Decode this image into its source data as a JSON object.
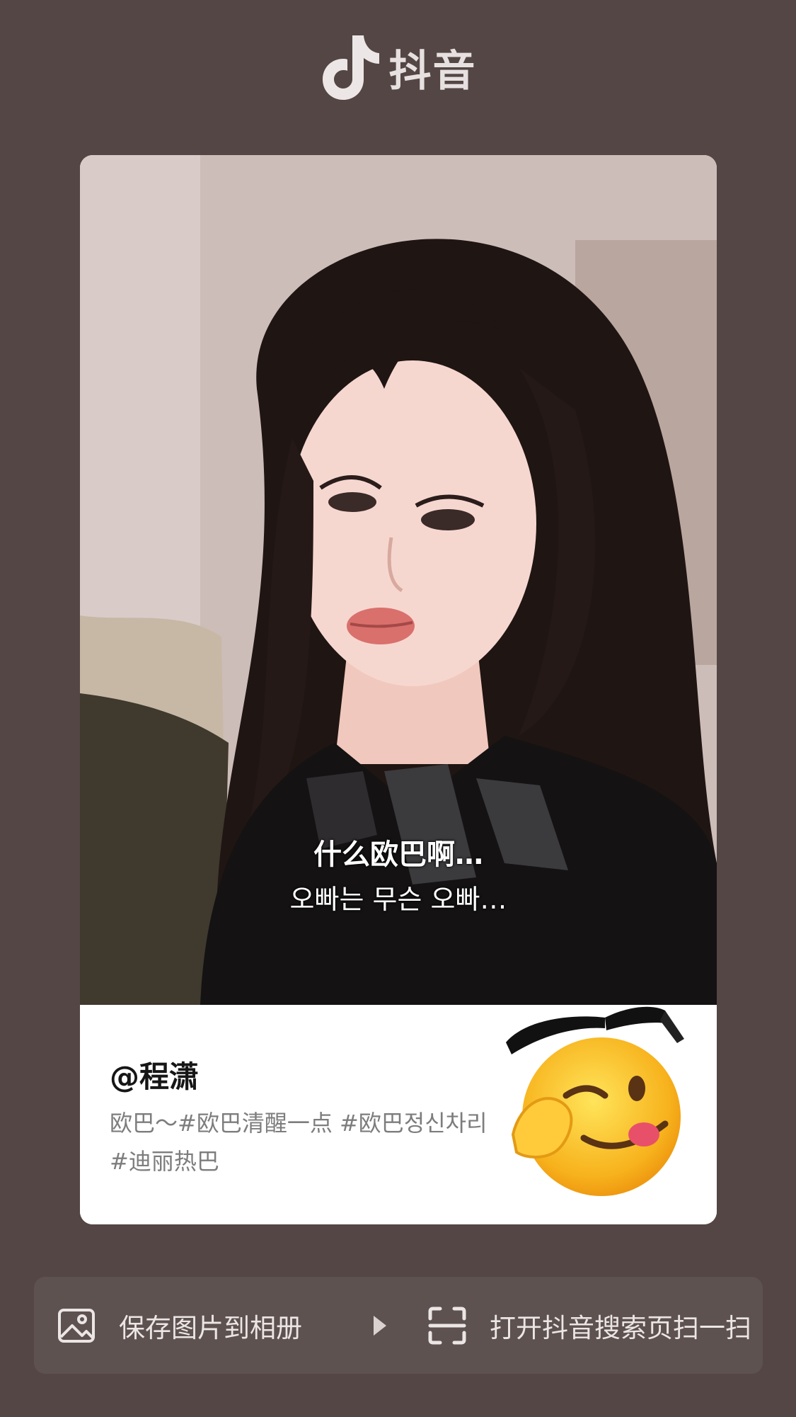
{
  "header": {
    "app_name": "抖音",
    "logo_icon": "douyin-note-icon"
  },
  "card": {
    "subtitle_zh": "什么欧巴啊…",
    "subtitle_ko": "오빠는 무슨 오빠…",
    "username": "@程潇",
    "caption": "欧巴～#欧巴清醒一点 #欧巴정신차리 #迪丽热巴",
    "sticker_icon": "cool-sunglasses-face-emoji-icon"
  },
  "actions": {
    "save_label": "保存图片到相册",
    "save_icon": "image-icon",
    "arrow_icon": "play-arrow-icon",
    "scan_label": "打开抖音搜索页扫一扫",
    "scan_icon": "scan-frame-icon"
  },
  "colors": {
    "background": "#544644",
    "action_bar": "#5e5250",
    "card": "#ffffff",
    "caption_text": "#7d7d7d"
  }
}
